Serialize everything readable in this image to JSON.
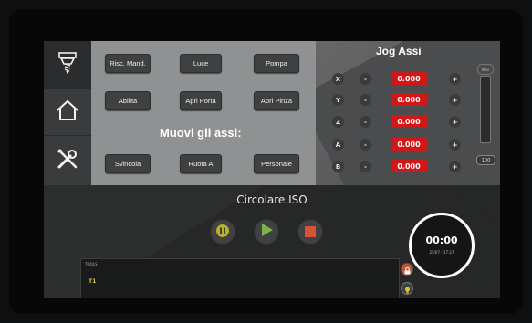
{
  "sidebar": {
    "items": [
      {
        "icon": "spindle-icon"
      },
      {
        "icon": "home-icon"
      },
      {
        "icon": "tools-icon"
      }
    ]
  },
  "controls": {
    "row1": [
      "Risc. Mand.",
      "Luce",
      "Pompa"
    ],
    "row2": [
      "Abilita",
      "Apri Porta",
      "Apri Pinza"
    ],
    "row3": [
      "Svincola",
      "Ruota A",
      "Personale"
    ],
    "axes_title": "Muovi gli assi:"
  },
  "jog": {
    "title": "Jog Assi",
    "axes": [
      {
        "axis": "X",
        "minus": "-",
        "value": "0.000",
        "plus": "+"
      },
      {
        "axis": "Y",
        "minus": "-",
        "value": "0.000",
        "plus": "+"
      },
      {
        "axis": "Z",
        "minus": "-",
        "value": "0.000",
        "plus": "+"
      },
      {
        "axis": "A",
        "minus": "-",
        "value": "0.000",
        "plus": "+"
      },
      {
        "axis": "B",
        "minus": "-",
        "value": "0.000",
        "plus": "+"
      }
    ],
    "slider_top": "Max",
    "slider_value": "100"
  },
  "program": {
    "file": "Circolare.ISO",
    "clock": "00:00",
    "clock_date": "25/07 - 17:27"
  },
  "console": {
    "header": "TOOLS",
    "line1": "T1"
  },
  "colors": {
    "value_bg": "#d01818",
    "pause": "#b9b12a",
    "play": "#7fb14a",
    "stop": "#d65335"
  }
}
